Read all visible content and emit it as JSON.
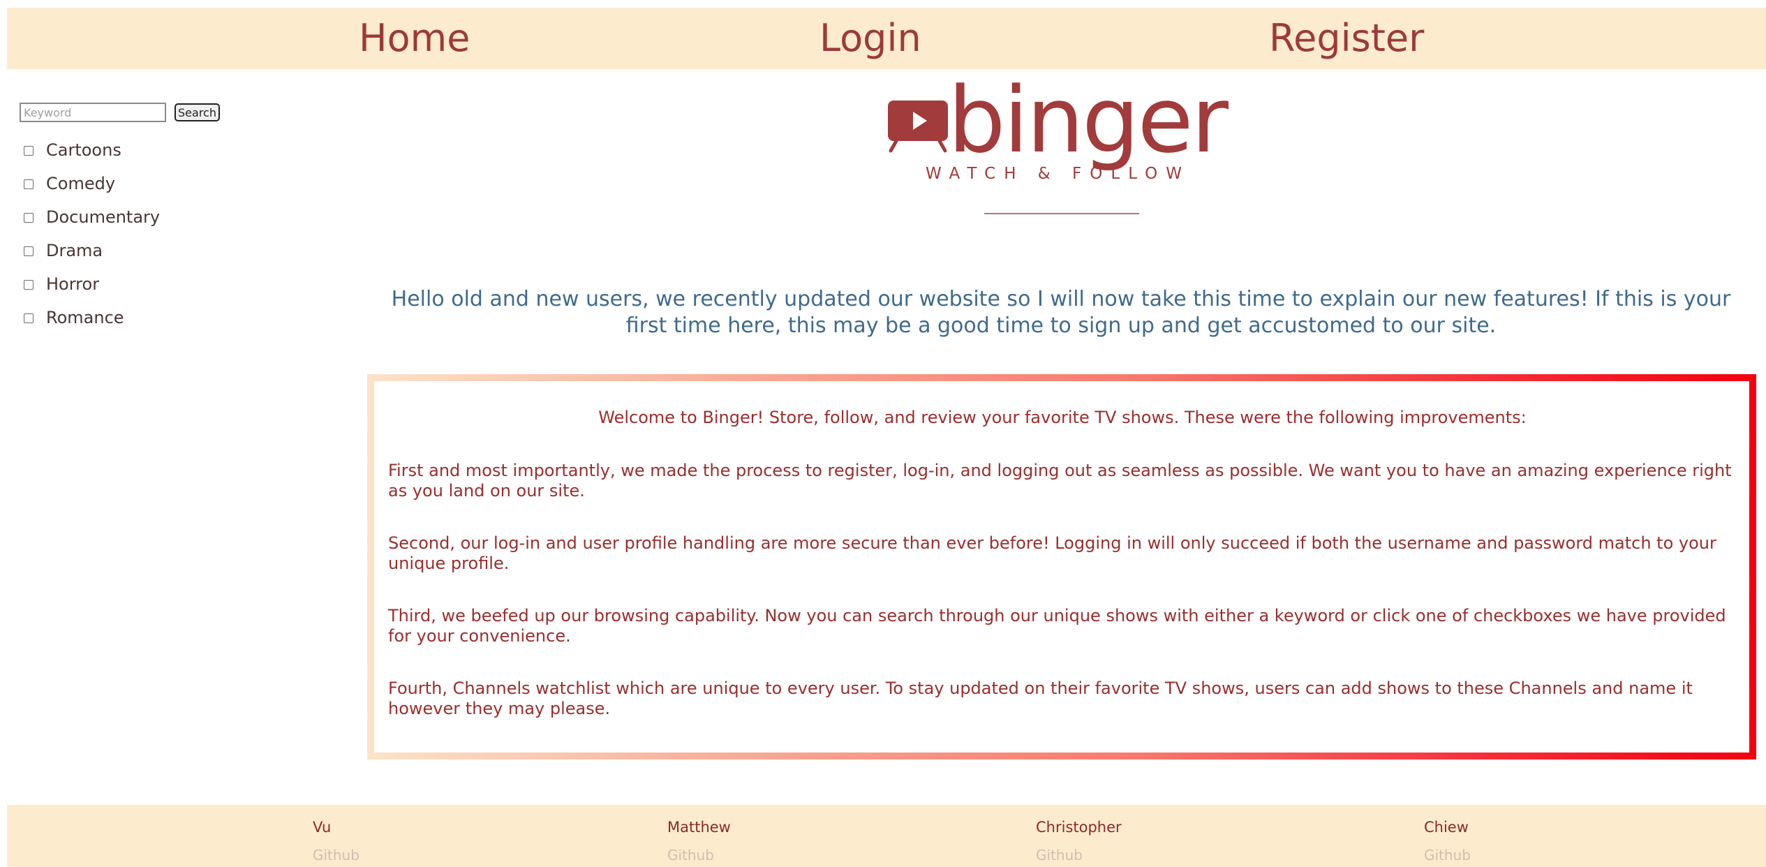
{
  "nav": {
    "home": "Home",
    "login": "Login",
    "register": "Register"
  },
  "sidebar": {
    "search_placeholder": "Keyword",
    "search_button": "Search",
    "genres": [
      "Cartoons",
      "Comedy",
      "Documentary",
      "Drama",
      "Horror",
      "Romance"
    ]
  },
  "logo": {
    "name": "binger",
    "tagline": "WATCH & FOLLOW",
    "icon": "play-tv-icon"
  },
  "intro": "Hello old and new users, we recently updated our website so I will now take this time to explain our new features! If this is your first time here, this may be a good time to sign up and get accustomed to our site.",
  "content": {
    "welcome": "Welcome to Binger! Store, follow, and review your favorite TV shows. These were the following improvements:",
    "features": [
      "First and most importantly, we made the process to register, log-in, and logging out as seamless as possible. We want you to have an amazing experience right as you land on our site.",
      "Second, our log-in and user profile handling are more secure than ever before! Logging in will only succeed if both the username and password match to your unique profile.",
      "Third, we beefed up our browsing capability. Now you can search through our unique shows with either a keyword or click one of checkboxes we have provided for your convenience.",
      "Fourth, Channels watchlist which are unique to every user. To stay updated on their favorite TV shows, users can add shows to these Channels and name it however they may please."
    ]
  },
  "footer": {
    "credits": [
      {
        "name": "Vu",
        "link": "Github"
      },
      {
        "name": "Matthew",
        "link": "Github"
      },
      {
        "name": "Christopher",
        "link": "Github"
      },
      {
        "name": "Chiew",
        "link": "Github"
      }
    ]
  },
  "colors": {
    "nav_bg": "#fdebce",
    "brand": "#a23b3b",
    "intro_text": "#3f6b8c",
    "gradient_start": "#fde3c8",
    "gradient_end": "#f4000d"
  }
}
